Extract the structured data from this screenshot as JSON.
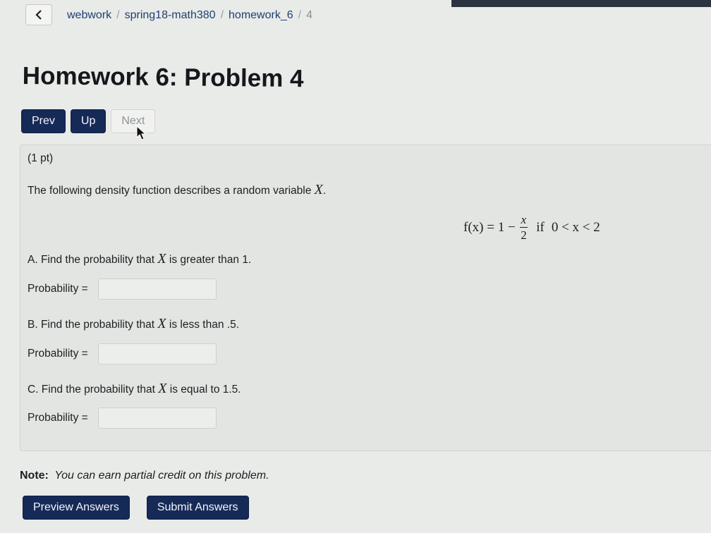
{
  "breadcrumb": {
    "items": [
      "webwork",
      "spring18-math380",
      "homework_6"
    ],
    "current": "4"
  },
  "page": {
    "title": "Homework 6: Problem 4"
  },
  "nav": {
    "prev_label": "Prev",
    "up_label": "Up",
    "next_label": "Next"
  },
  "problem": {
    "points": "(1 pt)",
    "intro": "The following density function describes a random variable",
    "variable": "X",
    "formula": {
      "lhs": "f(x) = 1 −",
      "frac_num": "x",
      "frac_den": "2",
      "condition_word": "if",
      "condition": "0 < x < 2"
    },
    "parts": [
      {
        "question_before": "A. Find the probability that",
        "question_after": "is greater than 1.",
        "answer_label": "Probability =",
        "answer_value": ""
      },
      {
        "question_before": "B. Find the probability that",
        "question_after": "is less than .5.",
        "answer_label": "Probability =",
        "answer_value": ""
      },
      {
        "question_before": "C. Find the probability that",
        "question_after": "is equal to 1.5.",
        "answer_label": "Probability =",
        "answer_value": ""
      }
    ]
  },
  "note": {
    "label": "Note:",
    "text": "You can earn partial credit on this problem."
  },
  "actions": {
    "preview_label": "Preview Answers",
    "submit_label": "Submit Answers"
  },
  "icons": {
    "back": "chevron-left-icon",
    "cursor": "mouse-cursor-icon"
  }
}
